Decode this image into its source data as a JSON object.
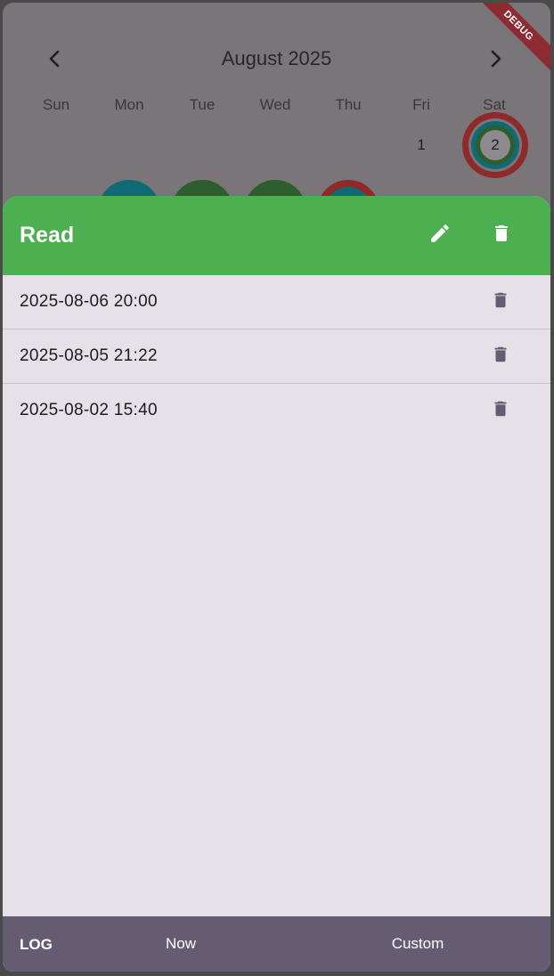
{
  "calendar": {
    "month_title": "August 2025",
    "prev_icon": "chevron-left-icon",
    "next_icon": "chevron-right-icon",
    "prev_glyph": "‹",
    "next_glyph": "›",
    "weekdays": [
      "Sun",
      "Mon",
      "Tue",
      "Wed",
      "Thu",
      "Fri",
      "Sat"
    ],
    "days": [
      "1",
      "2"
    ]
  },
  "debug_banner": "DEBUG",
  "sheet": {
    "title": "Read",
    "edit_icon": "pencil-icon",
    "delete_icon": "trash-icon",
    "header_color": "#4caf50",
    "entries": [
      {
        "timestamp": "2025-08-06 20:00"
      },
      {
        "timestamp": "2025-08-05 21:22"
      },
      {
        "timestamp": "2025-08-02 15:40"
      }
    ]
  },
  "bottom_bar": {
    "log_label": "LOG",
    "now_label": "Now",
    "custom_label": "Custom",
    "background": "#655b72"
  }
}
